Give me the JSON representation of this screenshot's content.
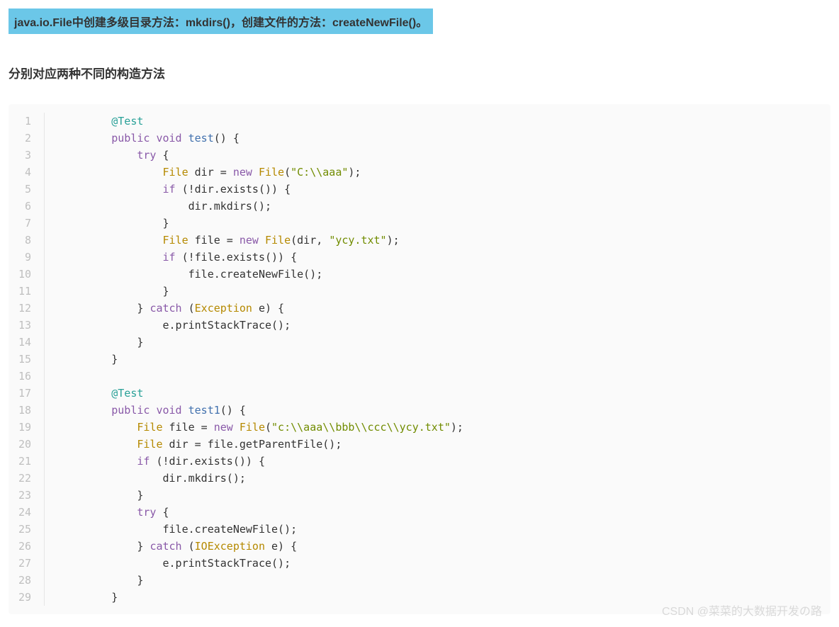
{
  "banner": "java.io.File中创建多级目录方法：mkdirs()，创建文件的方法：createNewFile()。",
  "subheading": "分别对应两种不同的构造方法",
  "watermark": "CSDN @菜菜的大数据开发の路",
  "code": {
    "lineCount": 29,
    "lines": [
      [
        [
          "        "
        ],
        [
          "@Test",
          "anno2"
        ]
      ],
      [
        [
          "        "
        ],
        [
          "public",
          "kw"
        ],
        [
          " "
        ],
        [
          "void",
          "kw"
        ],
        [
          " "
        ],
        [
          "test",
          "fn"
        ],
        [
          "() {"
        ]
      ],
      [
        [
          "            "
        ],
        [
          "try",
          "kw"
        ],
        [
          " {"
        ]
      ],
      [
        [
          "                "
        ],
        [
          "File",
          "type"
        ],
        [
          " dir = "
        ],
        [
          "new",
          "kw"
        ],
        [
          " "
        ],
        [
          "File",
          "type"
        ],
        [
          "("
        ],
        [
          "\"C:\\\\aaa\"",
          "str"
        ],
        [
          ");"
        ]
      ],
      [
        [
          "                "
        ],
        [
          "if",
          "kw"
        ],
        [
          " (!dir.exists()) {"
        ]
      ],
      [
        [
          "                    dir.mkdirs();"
        ]
      ],
      [
        [
          "                }"
        ]
      ],
      [
        [
          "                "
        ],
        [
          "File",
          "type"
        ],
        [
          " file = "
        ],
        [
          "new",
          "kw"
        ],
        [
          " "
        ],
        [
          "File",
          "type"
        ],
        [
          "(dir, "
        ],
        [
          "\"ycy.txt\"",
          "str"
        ],
        [
          ");"
        ]
      ],
      [
        [
          "                "
        ],
        [
          "if",
          "kw"
        ],
        [
          " (!file.exists()) {"
        ]
      ],
      [
        [
          "                    file.createNewFile();"
        ]
      ],
      [
        [
          "                }"
        ]
      ],
      [
        [
          "            } "
        ],
        [
          "catch",
          "kw"
        ],
        [
          " ("
        ],
        [
          "Exception",
          "type"
        ],
        [
          " e) {"
        ]
      ],
      [
        [
          "                e.printStackTrace();"
        ]
      ],
      [
        [
          "            }"
        ]
      ],
      [
        [
          "        }"
        ]
      ],
      [
        [
          ""
        ]
      ],
      [
        [
          "        "
        ],
        [
          "@Test",
          "anno2"
        ]
      ],
      [
        [
          "        "
        ],
        [
          "public",
          "kw"
        ],
        [
          " "
        ],
        [
          "void",
          "kw"
        ],
        [
          " "
        ],
        [
          "test1",
          "fn"
        ],
        [
          "() {"
        ]
      ],
      [
        [
          "            "
        ],
        [
          "File",
          "type"
        ],
        [
          " file = "
        ],
        [
          "new",
          "kw"
        ],
        [
          " "
        ],
        [
          "File",
          "type"
        ],
        [
          "("
        ],
        [
          "\"c:\\\\aaa\\\\bbb\\\\ccc\\\\ycy.txt\"",
          "str"
        ],
        [
          ");"
        ]
      ],
      [
        [
          "            "
        ],
        [
          "File",
          "type"
        ],
        [
          " dir = file.getParentFile();"
        ]
      ],
      [
        [
          "            "
        ],
        [
          "if",
          "kw"
        ],
        [
          " (!dir.exists()) {"
        ]
      ],
      [
        [
          "                dir.mkdirs();"
        ]
      ],
      [
        [
          "            }"
        ]
      ],
      [
        [
          "            "
        ],
        [
          "try",
          "kw"
        ],
        [
          " {"
        ]
      ],
      [
        [
          "                file.createNewFile();"
        ]
      ],
      [
        [
          "            } "
        ],
        [
          "catch",
          "kw"
        ],
        [
          " ("
        ],
        [
          "IOException",
          "type"
        ],
        [
          " e) {"
        ]
      ],
      [
        [
          "                e.printStackTrace();"
        ]
      ],
      [
        [
          "            }"
        ]
      ],
      [
        [
          "        }"
        ]
      ]
    ]
  }
}
